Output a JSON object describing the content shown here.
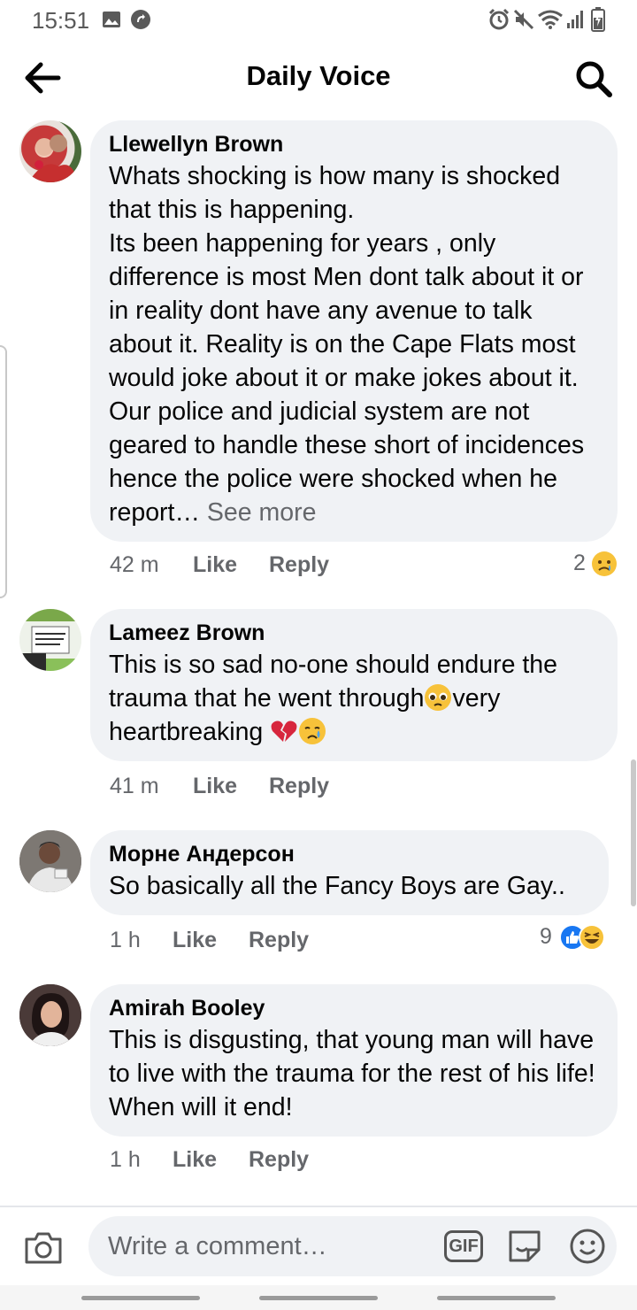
{
  "status_bar": {
    "time": "15:51",
    "left_icons": [
      "image-icon",
      "sync-icon"
    ],
    "right_icons": [
      "alarm-icon",
      "mute-icon",
      "wifi-icon",
      "signal-icon",
      "battery-icon"
    ]
  },
  "header": {
    "title": "Daily Voice",
    "back_icon": "arrow-left-icon",
    "search_icon": "search-icon"
  },
  "comments": [
    {
      "author": "Llewellyn Brown",
      "text": "Whats shocking is how many is shocked that this is happening.\nIts been happening for years , only difference is most Men dont talk about it or in reality dont have any avenue to talk about it. Reality is on the Cape Flats most would joke about  it or make jokes about it. Our police and judicial system are not geared to handle these short of incidences hence the police were shocked when he report…",
      "see_more": "See more",
      "time": "42 m",
      "like": "Like",
      "reply": "Reply",
      "reaction_count": "2",
      "reactions": [
        "sad-icon"
      ]
    },
    {
      "author": "Lameez Brown",
      "text_a": "This is so sad no-one should endure the trauma that he went through",
      "text_b": "very heartbreaking ",
      "inline_emojis": [
        "pleading-face-emoji",
        "broken-heart-emoji",
        "crying-face-emoji"
      ],
      "time": "41 m",
      "like": "Like",
      "reply": "Reply"
    },
    {
      "author": "Морне Андерсон",
      "text": "So basically all the Fancy Boys are Gay..",
      "time": "1 h",
      "like": "Like",
      "reply": "Reply",
      "reaction_count": "9",
      "reactions": [
        "like-icon",
        "haha-icon"
      ]
    },
    {
      "author": "Amirah Booley",
      "text": "This is disgusting, that young man will have to live with the trauma for the rest of his life! When will it end!",
      "time": "1 h",
      "like": "Like",
      "reply": "Reply"
    }
  ],
  "composer": {
    "placeholder": "Write a comment…",
    "camera_icon": "camera-icon",
    "gif_label": "GIF",
    "sticker_icon": "sticker-icon",
    "emoji_icon": "smiley-icon"
  },
  "colors": {
    "bubble": "#f0f2f5",
    "secondary_text": "#65676b",
    "like_blue": "#1877f2",
    "reaction_yellow": "#f7c23a"
  }
}
